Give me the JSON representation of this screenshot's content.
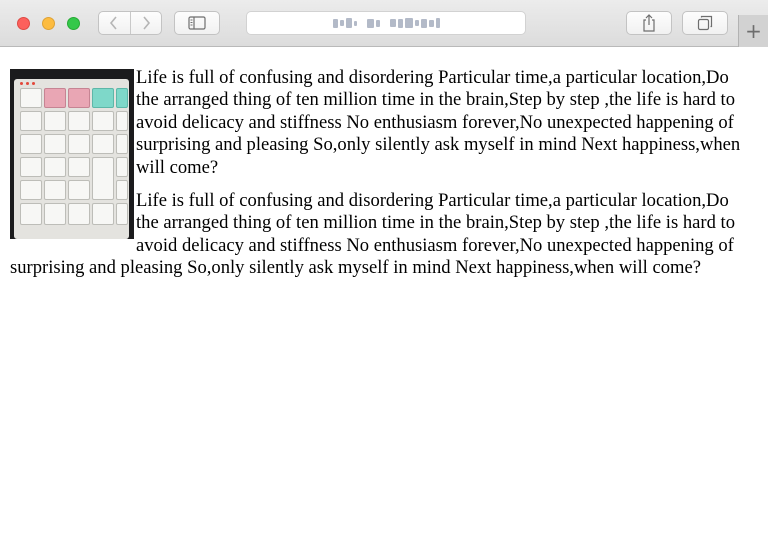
{
  "browser": {
    "icons": {
      "back": "chevron-left-icon",
      "forward": "chevron-right-icon",
      "sidebar": "sidebar-icon",
      "share": "share-icon",
      "tabs": "tab-overview-icon",
      "new_tab": "plus-icon"
    },
    "new_tab_label": "+",
    "traffic_colors": {
      "close": "#fc605c",
      "minimize": "#fdbc40",
      "zoom": "#34c84a"
    }
  },
  "page": {
    "image": {
      "subject": "keypad-photo"
    },
    "paragraphs": [
      "Life is full of confusing and disordering Particular time,a particular location,Do the arranged thing of ten million time in the brain,Step by step ,the life is hard to avoid delicacy and stiffness No enthusiasm forever,No unexpected happening of surprising and pleasing So,only silently ask myself in mind Next happiness,when will come?",
      "Life is full of confusing and disordering Particular time,a particular location,Do the arranged thing of ten million time in the brain,Step by step ,the life is hard to avoid delicacy and stiffness No enthusiasm forever,No unexpected happening of surprising and pleasing So,only silently ask myself in mind Next happiness,when will come?"
    ]
  }
}
